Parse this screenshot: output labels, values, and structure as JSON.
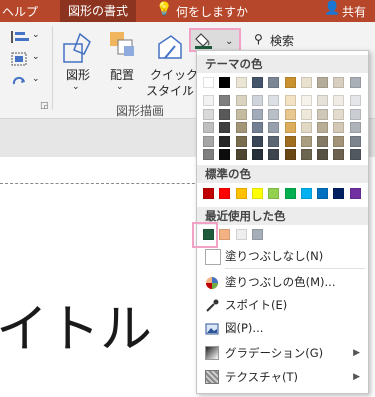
{
  "tabs": {
    "help": "ヘルプ",
    "shape_format": "図形の書式",
    "tell_me": "何をしますか",
    "share": "共有"
  },
  "ribbon": {
    "shape_label": "図形",
    "arrange_label": "配置",
    "quick_style_label_1": "クイック",
    "quick_style_label_2": "スタイル",
    "group_label": "図形描画",
    "search_label": "検索"
  },
  "slide": {
    "title_text": "イトル"
  },
  "dropdown": {
    "theme_colors_label": "テーマの色",
    "standard_colors_label": "標準の色",
    "recent_colors_label": "最近使用した色",
    "no_fill": "塗りつぶしなし(N)",
    "more_colors": "塗りつぶしの色(M)...",
    "eyedropper": "スポイト(E)",
    "picture": "図(P)...",
    "gradient": "グラデーション(G)",
    "texture": "テクスチャ(T)"
  },
  "theme_top": [
    "#ffffff",
    "#000000",
    "#e7e6e6",
    "#44546a",
    "#4472c4",
    "#ed7d31",
    "#a5a5a5",
    "#ffc000",
    "#5b9bd5",
    "#70ad47"
  ],
  "theme_top_display": [
    "#ffffff",
    "#000000",
    "#eae5d5",
    "#44546a",
    "#7b8695",
    "#c9922e",
    "#e9e2cf",
    "#b5ad9b",
    "#d8cfc1",
    "#aab0b7"
  ],
  "theme_shades": [
    [
      "#f2f2f2",
      "#7f7f7f",
      "#d9d3c0",
      "#d0d5dc",
      "#dcdfe3",
      "#f4e2c4",
      "#f6f3ec",
      "#e6e2da",
      "#f1ede6",
      "#e4e6e9"
    ],
    [
      "#d9d9d9",
      "#595959",
      "#c4bba0",
      "#a2abb9",
      "#b9bfc7",
      "#e9c78e",
      "#ede8da",
      "#cfc8b8",
      "#e3dbce",
      "#cacdd2"
    ],
    [
      "#bfbfbf",
      "#3f3f3f",
      "#a29677",
      "#737f93",
      "#969fab",
      "#dead5b",
      "#e1d9c4",
      "#b8ae97",
      "#d4c9b6",
      "#aeb3ba"
    ],
    [
      "#a6a6a6",
      "#262626",
      "#7a6d4d",
      "#3b4757",
      "#5c6673",
      "#a06d1f",
      "#a99e7f",
      "#847a65",
      "#a39479",
      "#7c838c"
    ],
    [
      "#7f7f7f",
      "#0d0d0d",
      "#4f4632",
      "#262f3a",
      "#3d444d",
      "#6a4814",
      "#6c6550",
      "#575143",
      "#6d6250",
      "#525860"
    ]
  ],
  "standard_colors": [
    "#c00000",
    "#ff0000",
    "#ffc000",
    "#ffff00",
    "#92d050",
    "#00b050",
    "#00b0f0",
    "#0070c0",
    "#002060",
    "#7030a0"
  ],
  "recent_colors": [
    "#1e5b3c",
    "#f4b183",
    "#eeeeee",
    "#a5aeb8"
  ],
  "accent": {
    "ribbon": "#b7472a",
    "highlight": "#f2a2c4",
    "current_fill": "#1e5b3c"
  }
}
